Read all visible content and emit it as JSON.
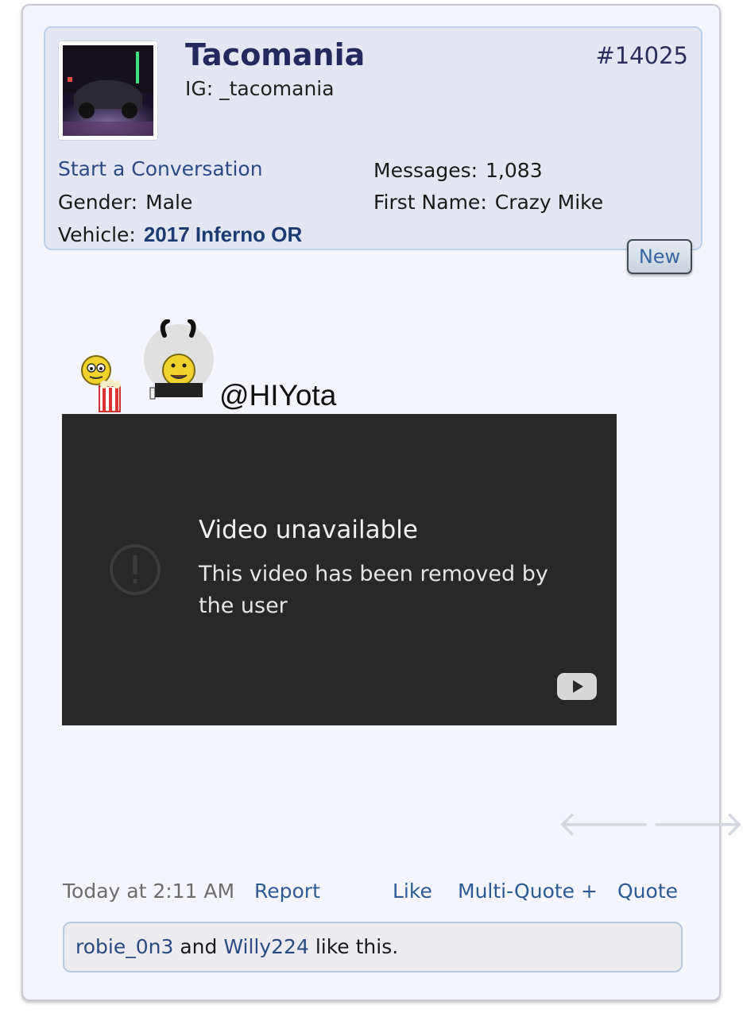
{
  "post": {
    "username": "Tacomania",
    "user_title": "IG: _tacomania",
    "post_number": "#14025",
    "start_conversation": "Start a Conversation",
    "gender_label": "Gender:",
    "gender_value": "Male",
    "vehicle_label": "Vehicle:",
    "vehicle_value": "2017 Inferno OR",
    "messages_label": "Messages:",
    "messages_value": "1,083",
    "first_name_label": "First Name:",
    "first_name_value": "Crazy Mike",
    "new_badge": "New",
    "mention": "@HIYota"
  },
  "video": {
    "title": "Video unavailable",
    "message": "This video has been removed by the user"
  },
  "nav": {
    "prev_icon": "arrow-left-icon",
    "next_icon": "arrow-right-icon",
    "prev_glyph": "🡐",
    "next_glyph": "🡒"
  },
  "footer": {
    "timestamp": "Today at 2:11 AM",
    "report": "Report",
    "like": "Like",
    "multi_quote": "Multi-Quote +",
    "quote": "Quote"
  },
  "likes": {
    "user1": "robie_0n3",
    "and": "and",
    "user2": "Willy224",
    "suffix": "like this."
  },
  "colors": {
    "username": "#22295e",
    "link": "#2d5b95",
    "video_bg": "#282828",
    "userbox_bg": "#e3e6f3"
  }
}
